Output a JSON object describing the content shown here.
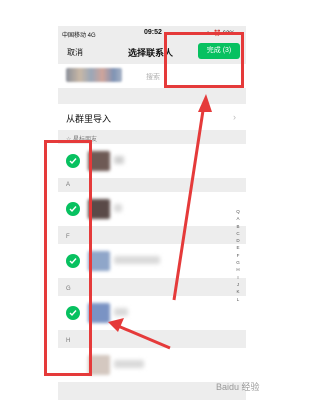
{
  "status_bar": {
    "carrier": "中国移动 4G",
    "time": "09:52",
    "battery": "62%"
  },
  "nav": {
    "cancel": "取消",
    "title": "选择联系人",
    "done": "完成 (3)"
  },
  "search": {
    "placeholder": "搜索"
  },
  "group_import": {
    "label": "从群里导入"
  },
  "sections": {
    "starred": "☆ 星标朋友",
    "a": "A",
    "f": "F",
    "g": "G",
    "h": "H"
  },
  "index_letters": [
    "Q",
    "A",
    "B",
    "C",
    "D",
    "E",
    "F",
    "G",
    "H",
    "I",
    "J",
    "K",
    "L"
  ],
  "watermark": "Baidu 经验",
  "colors": {
    "accent": "#07c160",
    "annotation": "#e53a3a"
  }
}
